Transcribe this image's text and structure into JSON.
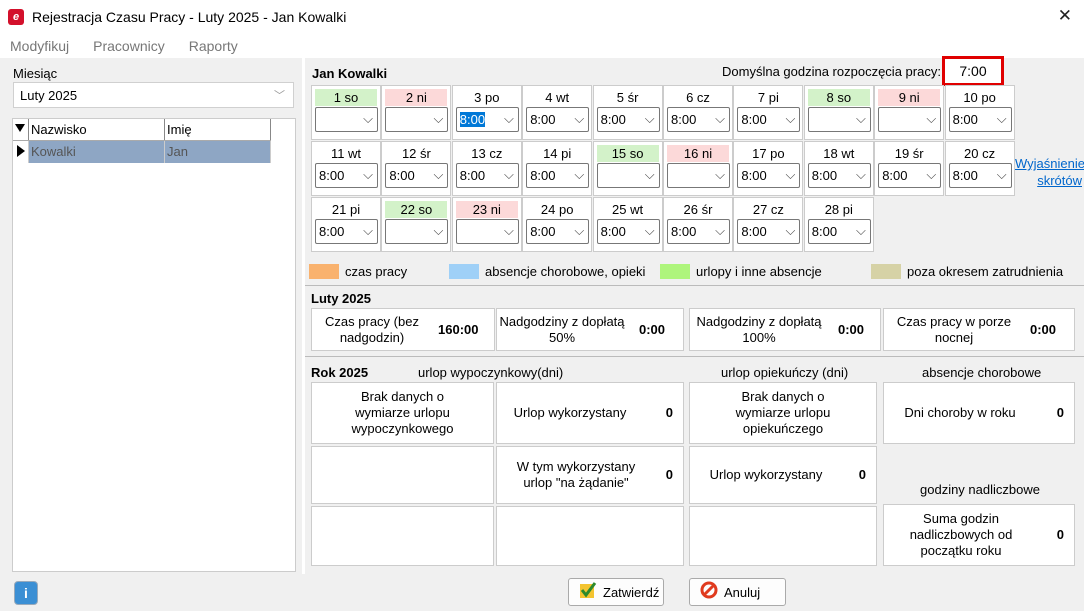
{
  "window": {
    "title": "Rejestracja Czasu Pracy - Luty 2025 - Jan Kowalki",
    "close": "✕"
  },
  "menu": [
    "Modyfikuj",
    "Pracownicy",
    "Raporty"
  ],
  "left": {
    "month_label": "Miesiąc",
    "month_value": "Luty 2025",
    "col_surname": "Nazwisko",
    "col_name": "Imię",
    "row": {
      "surname": "Kowalki",
      "name": "Jan"
    }
  },
  "employee": "Jan Kowalki",
  "default_start": {
    "label": "Domyślna godzina rozpoczęcia pracy:",
    "value": "7:00"
  },
  "days": [
    {
      "label": "1 so",
      "type": "sat",
      "value": ""
    },
    {
      "label": "2 ni",
      "type": "sun",
      "value": ""
    },
    {
      "label": "3 po",
      "type": "",
      "value": "8:00",
      "focus": true
    },
    {
      "label": "4 wt",
      "type": "",
      "value": "8:00"
    },
    {
      "label": "5 śr",
      "type": "",
      "value": "8:00"
    },
    {
      "label": "6 cz",
      "type": "",
      "value": "8:00"
    },
    {
      "label": "7 pi",
      "type": "",
      "value": "8:00"
    },
    {
      "label": "8 so",
      "type": "sat",
      "value": ""
    },
    {
      "label": "9 ni",
      "type": "sun",
      "value": ""
    },
    {
      "label": "10 po",
      "type": "",
      "value": "8:00"
    },
    {
      "label": "11 wt",
      "type": "",
      "value": "8:00"
    },
    {
      "label": "12 śr",
      "type": "",
      "value": "8:00"
    },
    {
      "label": "13 cz",
      "type": "",
      "value": "8:00"
    },
    {
      "label": "14 pi",
      "type": "",
      "value": "8:00"
    },
    {
      "label": "15 so",
      "type": "sat",
      "value": ""
    },
    {
      "label": "16 ni",
      "type": "sun",
      "value": ""
    },
    {
      "label": "17 po",
      "type": "",
      "value": "8:00"
    },
    {
      "label": "18 wt",
      "type": "",
      "value": "8:00"
    },
    {
      "label": "19 śr",
      "type": "",
      "value": "8:00"
    },
    {
      "label": "20 cz",
      "type": "",
      "value": "8:00"
    },
    {
      "label": "21 pi",
      "type": "",
      "value": "8:00"
    },
    {
      "label": "22 so",
      "type": "sat",
      "value": ""
    },
    {
      "label": "23 ni",
      "type": "sun",
      "value": ""
    },
    {
      "label": "24 po",
      "type": "",
      "value": "8:00"
    },
    {
      "label": "25 wt",
      "type": "",
      "value": "8:00"
    },
    {
      "label": "26 śr",
      "type": "",
      "value": "8:00"
    },
    {
      "label": "27 cz",
      "type": "",
      "value": "8:00"
    },
    {
      "label": "28 pi",
      "type": "",
      "value": "8:00"
    }
  ],
  "explain_link": [
    "Wyjaśnienie",
    "skrótów"
  ],
  "legend": [
    {
      "label": "czas pracy",
      "color": "#f9b26e"
    },
    {
      "label": "absencje chorobowe, opieki",
      "color": "#9fd0f7"
    },
    {
      "label": "urlopy i inne absencje",
      "color": "#aef57c"
    },
    {
      "label": "poza okresem zatrudnienia",
      "color": "#d6d2a6"
    }
  ],
  "month_section": {
    "title": "Luty 2025",
    "items": [
      {
        "label": "Czas pracy (bez nadgodzin)",
        "value": "160:00"
      },
      {
        "label": "Nadgodziny z dopłatą 50%",
        "value": "0:00"
      },
      {
        "label": "Nadgodziny z dopłatą 100%",
        "value": "0:00"
      },
      {
        "label": "Czas pracy w porze nocnej",
        "value": "0:00"
      }
    ]
  },
  "year_section": {
    "title": "Rok 2025",
    "col_vacation": "urlop wypoczynkowy(dni)",
    "col_care": "urlop opiekuńczy (dni)",
    "col_sick": "absencje chorobowe",
    "col_overtime": "godziny nadliczbowe",
    "vacation_nodata": "Brak danych o wymiarze urlopu wypoczynkowego",
    "vacation_used_label": "Urlop wykorzystany",
    "vacation_used": "0",
    "vacation_ondemand_label": "W tym wykorzystany urlop \"na żądanie\"",
    "vacation_ondemand": "0",
    "care_nodata": "Brak danych o wymiarze urlopu opiekuńczego",
    "care_used_label": "Urlop wykorzystany",
    "care_used": "0",
    "sick_label": "Dni choroby w roku",
    "sick": "0",
    "overtime_label": "Suma godzin nadliczbowych od początku roku",
    "overtime": "0"
  },
  "buttons": {
    "info": "i",
    "confirm": "Zatwierdź",
    "cancel": "Anuluj"
  },
  "chev": "⌵",
  "select_chev": "﹀"
}
